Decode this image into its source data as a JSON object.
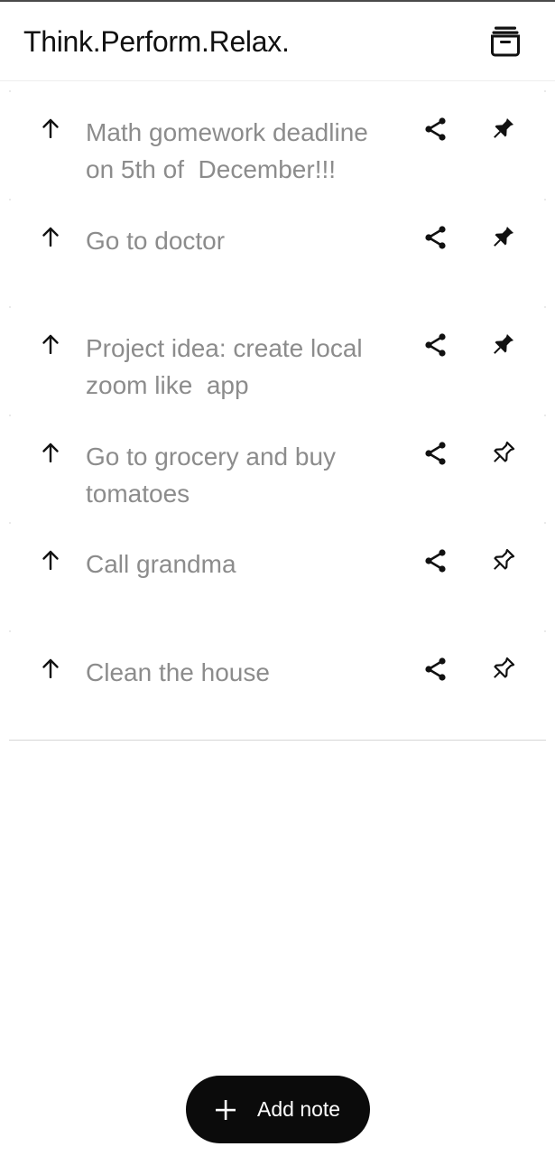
{
  "app": {
    "title": "Think.Perform.Relax.",
    "archive_icon": "archive-box-icon"
  },
  "notes": [
    {
      "text": "Math gomework deadline\non 5th of  December!!!",
      "pinned": true
    },
    {
      "text": "Go to doctor",
      "pinned": true
    },
    {
      "text": "Project idea: create local\nzoom like  app",
      "pinned": true
    },
    {
      "text": "Go to grocery and buy\ntomatoes",
      "pinned": false
    },
    {
      "text": "Call grandma",
      "pinned": false
    },
    {
      "text": "Clean the house",
      "pinned": false
    }
  ],
  "row_icons": {
    "move_up": "arrow-up-icon",
    "share": "share-icon",
    "pin_filled": "pin-filled-icon",
    "pin_outline": "pin-outline-icon"
  },
  "fab": {
    "label": "Add note",
    "icon": "plus-icon",
    "background": "#0b0b0b",
    "text_color": "#ffffff"
  },
  "colors": {
    "note_text": "#8c8c8c",
    "title_text": "#111111",
    "divider": "#d6d6d6"
  }
}
